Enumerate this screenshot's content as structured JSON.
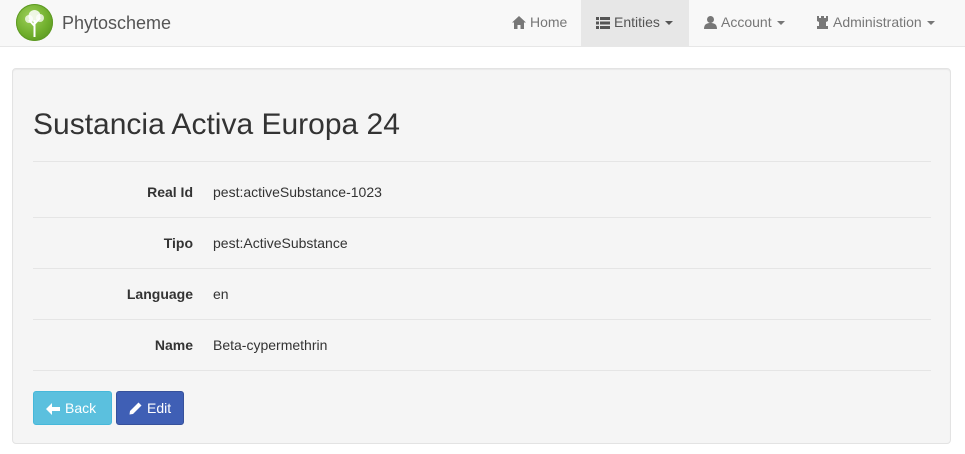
{
  "navbar": {
    "brand": "Phytoscheme",
    "items": [
      {
        "label": "Home",
        "icon": "home-icon"
      },
      {
        "label": "Entities",
        "icon": "list-icon",
        "active": true
      },
      {
        "label": "Account",
        "icon": "user-icon"
      },
      {
        "label": "Administration",
        "icon": "tower-icon"
      }
    ]
  },
  "detail": {
    "title": "Sustancia Activa Europa 24",
    "rows": [
      {
        "label": "Real Id",
        "value": "pest:activeSubstance-1023"
      },
      {
        "label": "Tipo",
        "value": "pest:ActiveSubstance"
      },
      {
        "label": "Language",
        "value": "en"
      },
      {
        "label": "Name",
        "value": "Beta-cypermethrin"
      }
    ]
  },
  "actions": {
    "back_label": "Back",
    "edit_label": "Edit"
  },
  "colors": {
    "navbar_bg": "#f8f8f8",
    "active_nav_bg": "#e7e7e7",
    "panel_bg": "#f5f5f5",
    "back_button": "#5bc0de",
    "edit_button": "#3f5fb5"
  }
}
